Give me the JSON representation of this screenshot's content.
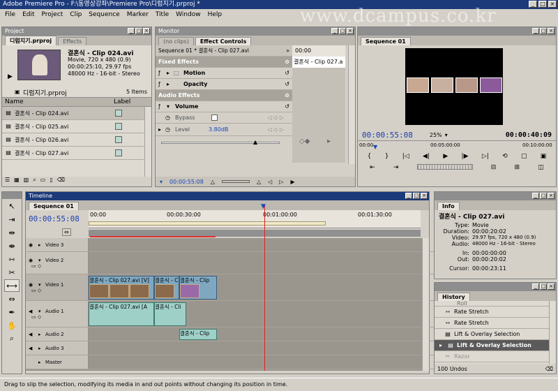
{
  "window": {
    "title": "Adobe Premiere Pro - F:\\동영상강좌\\Premiere Pro\\디럼지기.prproj *",
    "watermark": "www.dcampus.co.kr"
  },
  "menu": [
    "File",
    "Edit",
    "Project",
    "Clip",
    "Sequence",
    "Marker",
    "Title",
    "Window",
    "Help"
  ],
  "project": {
    "panel_title": "Project",
    "tabs": [
      "디럼지기.prproj",
      "Effects"
    ],
    "selected_clip": {
      "name": "결혼식 - Clip 024.avi",
      "type": "Movie, 720 x 480 (0.9)",
      "duration": "00:00:25:10, 29.97 fps",
      "audio": "48000 Hz - 16-bit - Stereo"
    },
    "project_name": "디럼지기.prproj",
    "item_count": "5 Items",
    "columns": [
      "Name",
      "Label"
    ],
    "items": [
      "결혼식 - Clip 024.avi",
      "결혼식 - Clip 025.avi",
      "결혼식 - Clip 026.avi",
      "결혼식 - Clip 027.avi"
    ]
  },
  "effect_controls": {
    "panel_title": "Monitor",
    "tabs": [
      "(no clips)",
      "Effect Controls"
    ],
    "sequence_label": "Sequence 01 * 결혼식 - Clip 027.avi",
    "timecode": "00:00",
    "clip_label": "결혼식 - Clip 027.a",
    "sections": {
      "fixed": "Fixed Effects",
      "motion": "Motion",
      "opacity": "Opacity",
      "audio": "Audio Effects",
      "volume": "Volume",
      "bypass": "Bypass",
      "level": "Level",
      "level_value": "3.80dB"
    },
    "bottom_timecode": "00:00:55:08"
  },
  "program": {
    "tab": "Sequence 01",
    "current_time": "00:00:55:08",
    "zoom": "25%",
    "duration": "00:00:40:09",
    "ruler": [
      "00:00",
      "00:05:00:00",
      "00:10:00:00"
    ]
  },
  "timeline": {
    "panel_title": "Timeline",
    "tab": "Sequence 01",
    "current_time": "00:00:55:08",
    "ruler": [
      "00:00",
      "00:00:30:00",
      "00:01:00:00",
      "00:01:30:00"
    ],
    "tracks": {
      "v3": "Video 3",
      "v2": "Video 2",
      "v1": "Video 1",
      "a1": "Audio 1",
      "a2": "Audio 2",
      "a3": "Audio 3",
      "master": "Master"
    },
    "clips": {
      "v1_a": "결혼식 - Clip 027.avi [V]",
      "v1_b": "결혼식 - Cli",
      "v1_c": "결혼식 - Clip",
      "a1_a": "결혼식 - Clip 027.avi [A",
      "a1_b": "결혼식 - Cli",
      "a2_a": "결혼식 - Clip"
    }
  },
  "info": {
    "tab": "Info",
    "clip_name": "결혼식 - Clip 027.avi",
    "rows": [
      {
        "k": "Type:",
        "v": "Movie"
      },
      {
        "k": "Duration:",
        "v": "00:00:20:02"
      },
      {
        "k": "Video:",
        "v": "29.97 fps, 720 x 480 (0.9)"
      },
      {
        "k": "Audio:",
        "v": "48000 Hz - 16-bit - Stereo"
      },
      {
        "k": "In:",
        "v": "00:00:00:00"
      },
      {
        "k": "Out:",
        "v": "00:00:20:02"
      },
      {
        "k": "Cursor:",
        "v": "00:00:23:11"
      }
    ]
  },
  "history": {
    "tab": "History",
    "items": [
      "Roll",
      "Rate Stretch",
      "Rate Stretch",
      "Lift & Overlay Selection",
      "Lift & Overlay Selection",
      "Razor"
    ],
    "undo_count": "100 Undos"
  },
  "status": "Drag to slip the selection, modifying its media in and out points without changing its position in time."
}
